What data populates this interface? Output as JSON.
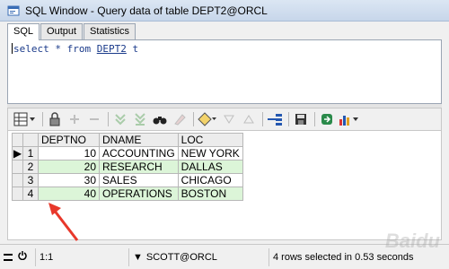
{
  "window": {
    "title": "SQL Window - Query data of table DEPT2@ORCL"
  },
  "tabs": [
    {
      "label": "SQL"
    },
    {
      "label": "Output"
    },
    {
      "label": "Statistics"
    }
  ],
  "editor": {
    "keyword_select": "select",
    "star": " * ",
    "keyword_from": "from",
    "table_name": "DEPT2",
    "alias": " t"
  },
  "toolbar": {
    "icons": [
      "grid-menu-icon",
      "lock-icon",
      "add-row-icon",
      "delete-row-icon",
      "next-records-icon",
      "last-records-icon",
      "find-icon",
      "clear-icon",
      "query-by-example-icon",
      "arrow-down-icon",
      "arrow-up-icon",
      "connect-icon",
      "save-icon",
      "export-icon",
      "chart-icon"
    ]
  },
  "grid": {
    "columns": [
      "DEPTNO",
      "DNAME",
      "LOC"
    ],
    "rows": [
      {
        "n": "1",
        "deptno": "10",
        "dname": "ACCOUNTING",
        "loc": "NEW YORK"
      },
      {
        "n": "2",
        "deptno": "20",
        "dname": "RESEARCH",
        "loc": "DALLAS"
      },
      {
        "n": "3",
        "deptno": "30",
        "dname": "SALES",
        "loc": "CHICAGO"
      },
      {
        "n": "4",
        "deptno": "40",
        "dname": "OPERATIONS",
        "loc": "BOSTON"
      }
    ],
    "current_row_indicator": "▶"
  },
  "status": {
    "position": "1:1",
    "connection": "SCOTT@ORCL",
    "message": "4 rows selected in 0.53 seconds"
  },
  "watermark": "Baidu",
  "colors": {
    "alt_row": "#dcf5d8",
    "arrow": "#e8382b"
  }
}
